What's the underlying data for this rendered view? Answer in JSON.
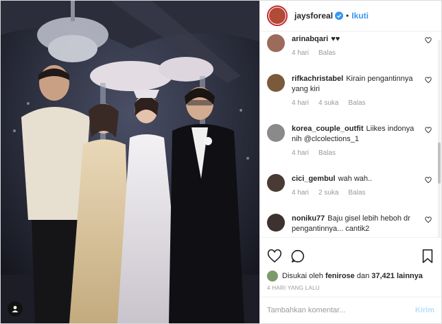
{
  "header": {
    "username": "jaysforeal",
    "separator": "•",
    "follow_label": "Ikuti"
  },
  "comments": [
    {
      "user": "arinabqari",
      "text": "♥♥",
      "time": "4 hari",
      "likes": "",
      "reply": "Balas",
      "avatar_color": "#9c6b5c"
    },
    {
      "user": "rifkachristabel",
      "text": "Kirain pengantinnya yang kiri",
      "time": "4 hari",
      "likes": "4 suka",
      "reply": "Balas",
      "avatar_color": "#7a5a3a"
    },
    {
      "user": "korea_couple_outfit",
      "text": "Liikes indonya nih @clcolections_1",
      "time": "4 hari",
      "likes": "",
      "reply": "Balas",
      "avatar_color": "#8a8a8a"
    },
    {
      "user": "cici_gembul",
      "text": "wah wah..",
      "time": "4 hari",
      "likes": "2 suka",
      "reply": "Balas",
      "avatar_color": "#4a3a36"
    },
    {
      "user": "noniku77",
      "text": "Baju gisel lebih heboh dr pengantinnya... cantik2",
      "time": "",
      "likes": "",
      "reply": "",
      "avatar_color": "#3e3230"
    }
  ],
  "likes": {
    "prefix": "Disukai oleh",
    "user": "fenirose",
    "joiner": "dan",
    "count": "37,421 lainnya"
  },
  "date": "4 HARI YANG LALU",
  "add_comment": {
    "placeholder": "Tambahkan komentar...",
    "post_label": "Kirim"
  },
  "icons": {
    "verified": "verified-badge-icon",
    "heart": "heart-icon",
    "comment": "comment-icon",
    "bookmark": "bookmark-icon",
    "user_tag": "user-tag-icon"
  },
  "colors": {
    "accent": "#3897f0",
    "text": "#262626",
    "muted": "#999999",
    "post_disabled": "#b2dffc"
  }
}
